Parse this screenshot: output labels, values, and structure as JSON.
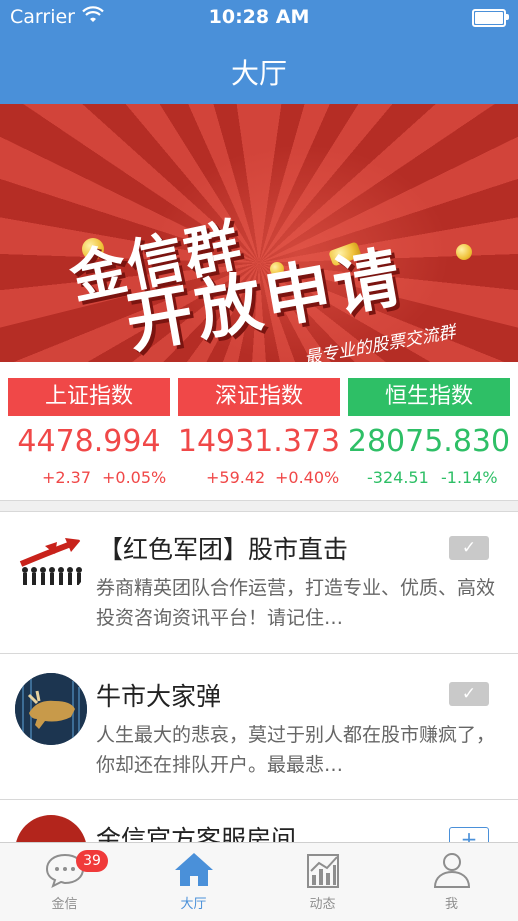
{
  "status_bar": {
    "carrier": "Carrier",
    "time": "10:28 AM"
  },
  "nav": {
    "title": "大厅"
  },
  "banner": {
    "line1": "金信群",
    "line2": "开放申请",
    "tagline": "最专业的股票交流群",
    "bag_symbol": "¥"
  },
  "indices": [
    {
      "name": "上证指数",
      "value": "4478.994",
      "change": "+2.37",
      "percent": "+0.05%",
      "color": "#f04848",
      "button_color": "#f04848"
    },
    {
      "name": "深证指数",
      "value": "14931.373",
      "change": "+59.42",
      "percent": "+0.40%",
      "color": "#f04848",
      "button_color": "#f04848"
    },
    {
      "name": "恒生指数",
      "value": "28075.830",
      "change": "-324.51",
      "percent": "-1.14%",
      "color": "#2ebf66",
      "button_color": "#2ebf66"
    }
  ],
  "groups": [
    {
      "title": "【红色军团】股市直击",
      "description": "券商精英团队合作运营，打造专业、优质、高效投资咨询资讯平台！请记住…",
      "action": "check"
    },
    {
      "title": "牛市大家弹",
      "description": "人生最大的悲哀，莫过于别人都在股市赚疯了，你却还在排队开户。最最悲…",
      "action": "check"
    },
    {
      "title": "金信官方客服房间",
      "description": "",
      "action": "plus"
    }
  ],
  "tabs": [
    {
      "label": "金信",
      "icon": "chat-bubble-icon",
      "badge": "39"
    },
    {
      "label": "大厅",
      "icon": "home-icon",
      "active": true
    },
    {
      "label": "动态",
      "icon": "chart-icon"
    },
    {
      "label": "我",
      "icon": "person-icon"
    }
  ]
}
